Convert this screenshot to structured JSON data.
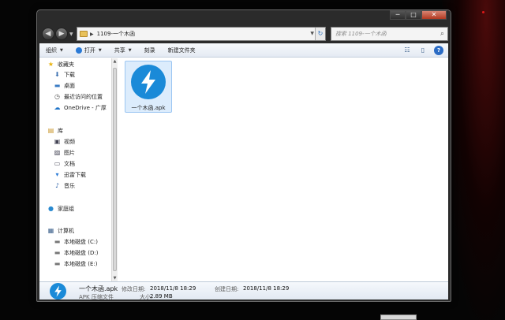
{
  "window": {
    "caption": {
      "minimize": "─",
      "maximize": "□",
      "close": "✕"
    }
  },
  "nav": {
    "back_icon": "◀",
    "forward_icon": "▶",
    "dropdown_icon": "▼",
    "address": {
      "separator": "▶",
      "folder": "1109-一个木函",
      "dropdown_icon": "▼",
      "refresh_icon": "↻"
    },
    "search": {
      "placeholder": "搜索 1109-一个木函",
      "icon": "⌕"
    }
  },
  "toolbar": {
    "organize": "组织",
    "open": "打开",
    "share": "共享",
    "burn": "刻录",
    "new_folder": "新建文件夹",
    "caret": "▼",
    "view_icon": "☷",
    "pane_icon": "▯",
    "help_icon": "?"
  },
  "sidebar": {
    "favorites": {
      "label": "收藏夹",
      "icon": "★",
      "items": [
        {
          "label": "下载",
          "icon": "⬇"
        },
        {
          "label": "桌面",
          "icon": "▬"
        },
        {
          "label": "最近访问的位置",
          "icon": "◷"
        },
        {
          "label": "OneDrive - 广厚",
          "icon": "☁"
        }
      ]
    },
    "libraries": {
      "label": "库",
      "icon": "▤",
      "items": [
        {
          "label": "视频",
          "icon": "▣"
        },
        {
          "label": "图片",
          "icon": "▨"
        },
        {
          "label": "文档",
          "icon": "▭"
        },
        {
          "label": "迅雷下载",
          "icon": "▾"
        },
        {
          "label": "音乐",
          "icon": "♪"
        }
      ]
    },
    "homegroup": {
      "label": "家庭组",
      "icon": "●"
    },
    "computer": {
      "label": "计算机",
      "icon": "▦",
      "items": [
        {
          "label": "本地磁盘 (C:)",
          "icon": "▬"
        },
        {
          "label": "本地磁盘 (D:)",
          "icon": "▬"
        },
        {
          "label": "本地磁盘 (E:)",
          "icon": "▬"
        }
      ]
    }
  },
  "scrollbar": {
    "up": "▲",
    "down": "▼"
  },
  "files": [
    {
      "name": "一个木函.apk",
      "icon": "lightning-icon"
    }
  ],
  "details": {
    "name": "一个木函.apk",
    "type": "APK 压缩文件",
    "modified_label": "修改日期:",
    "modified_value": "2018/11/8 18:29",
    "created_label": "创建日期:",
    "created_value": "2018/11/8 18:29",
    "size_label": "大小:",
    "size_value": "2.89 MB"
  },
  "colors": {
    "accent": "#1a8ad8",
    "selection": "#dcecfc",
    "window_frame": "#2b2b2b"
  }
}
